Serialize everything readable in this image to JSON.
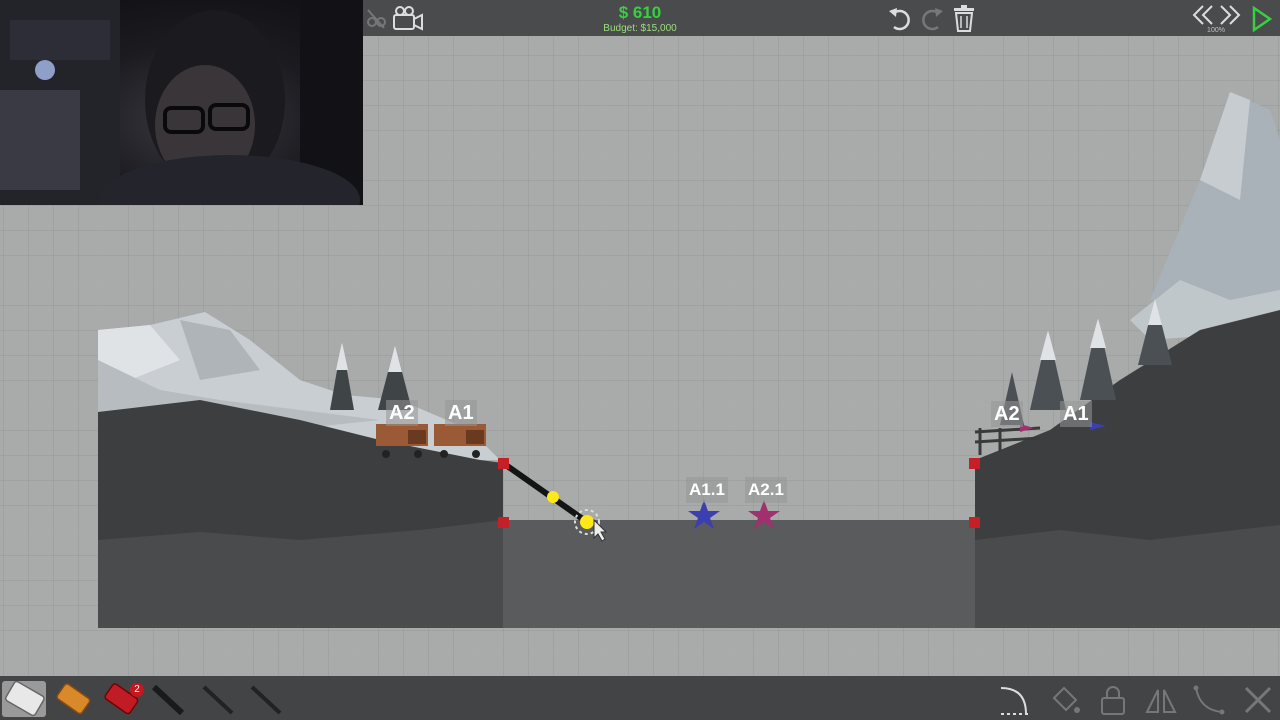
{
  "hud": {
    "cost": "$ 610",
    "budget": "Budget: $15,000",
    "sim_speed": "100%"
  },
  "icons": {
    "top_left": [
      "hide-vehicles-icon",
      "camera-icon"
    ],
    "top_center": [
      "undo-icon",
      "redo-icon",
      "trash-icon"
    ],
    "top_right": [
      "rewind-icon",
      "fast-forward-icon",
      "play-icon"
    ],
    "materials": [
      "road-material-icon",
      "wood-material-icon",
      "reinforced-road-material-icon",
      "steel-material-icon",
      "rope-material-icon",
      "cable-material-icon"
    ],
    "bottom_right": [
      "curve-tool-icon",
      "paint-bucket-icon",
      "lock-icon",
      "mirror-icon",
      "spline-icon",
      "delete-mode-icon"
    ]
  },
  "materials": {
    "reinforced_road_count": "2"
  },
  "level": {
    "left_checkpoints": [
      "A2",
      "A1"
    ],
    "right_checkpoints": [
      "A2",
      "A1"
    ],
    "mid_checkpoints": [
      "A1.1",
      "A2.1"
    ]
  },
  "colors": {
    "budget_green": "#36d13f",
    "anchor_red": "#c61f28",
    "joint_yellow": "#ffe81a",
    "star_blue": "#3b3fb0",
    "star_magenta": "#a1306f"
  }
}
